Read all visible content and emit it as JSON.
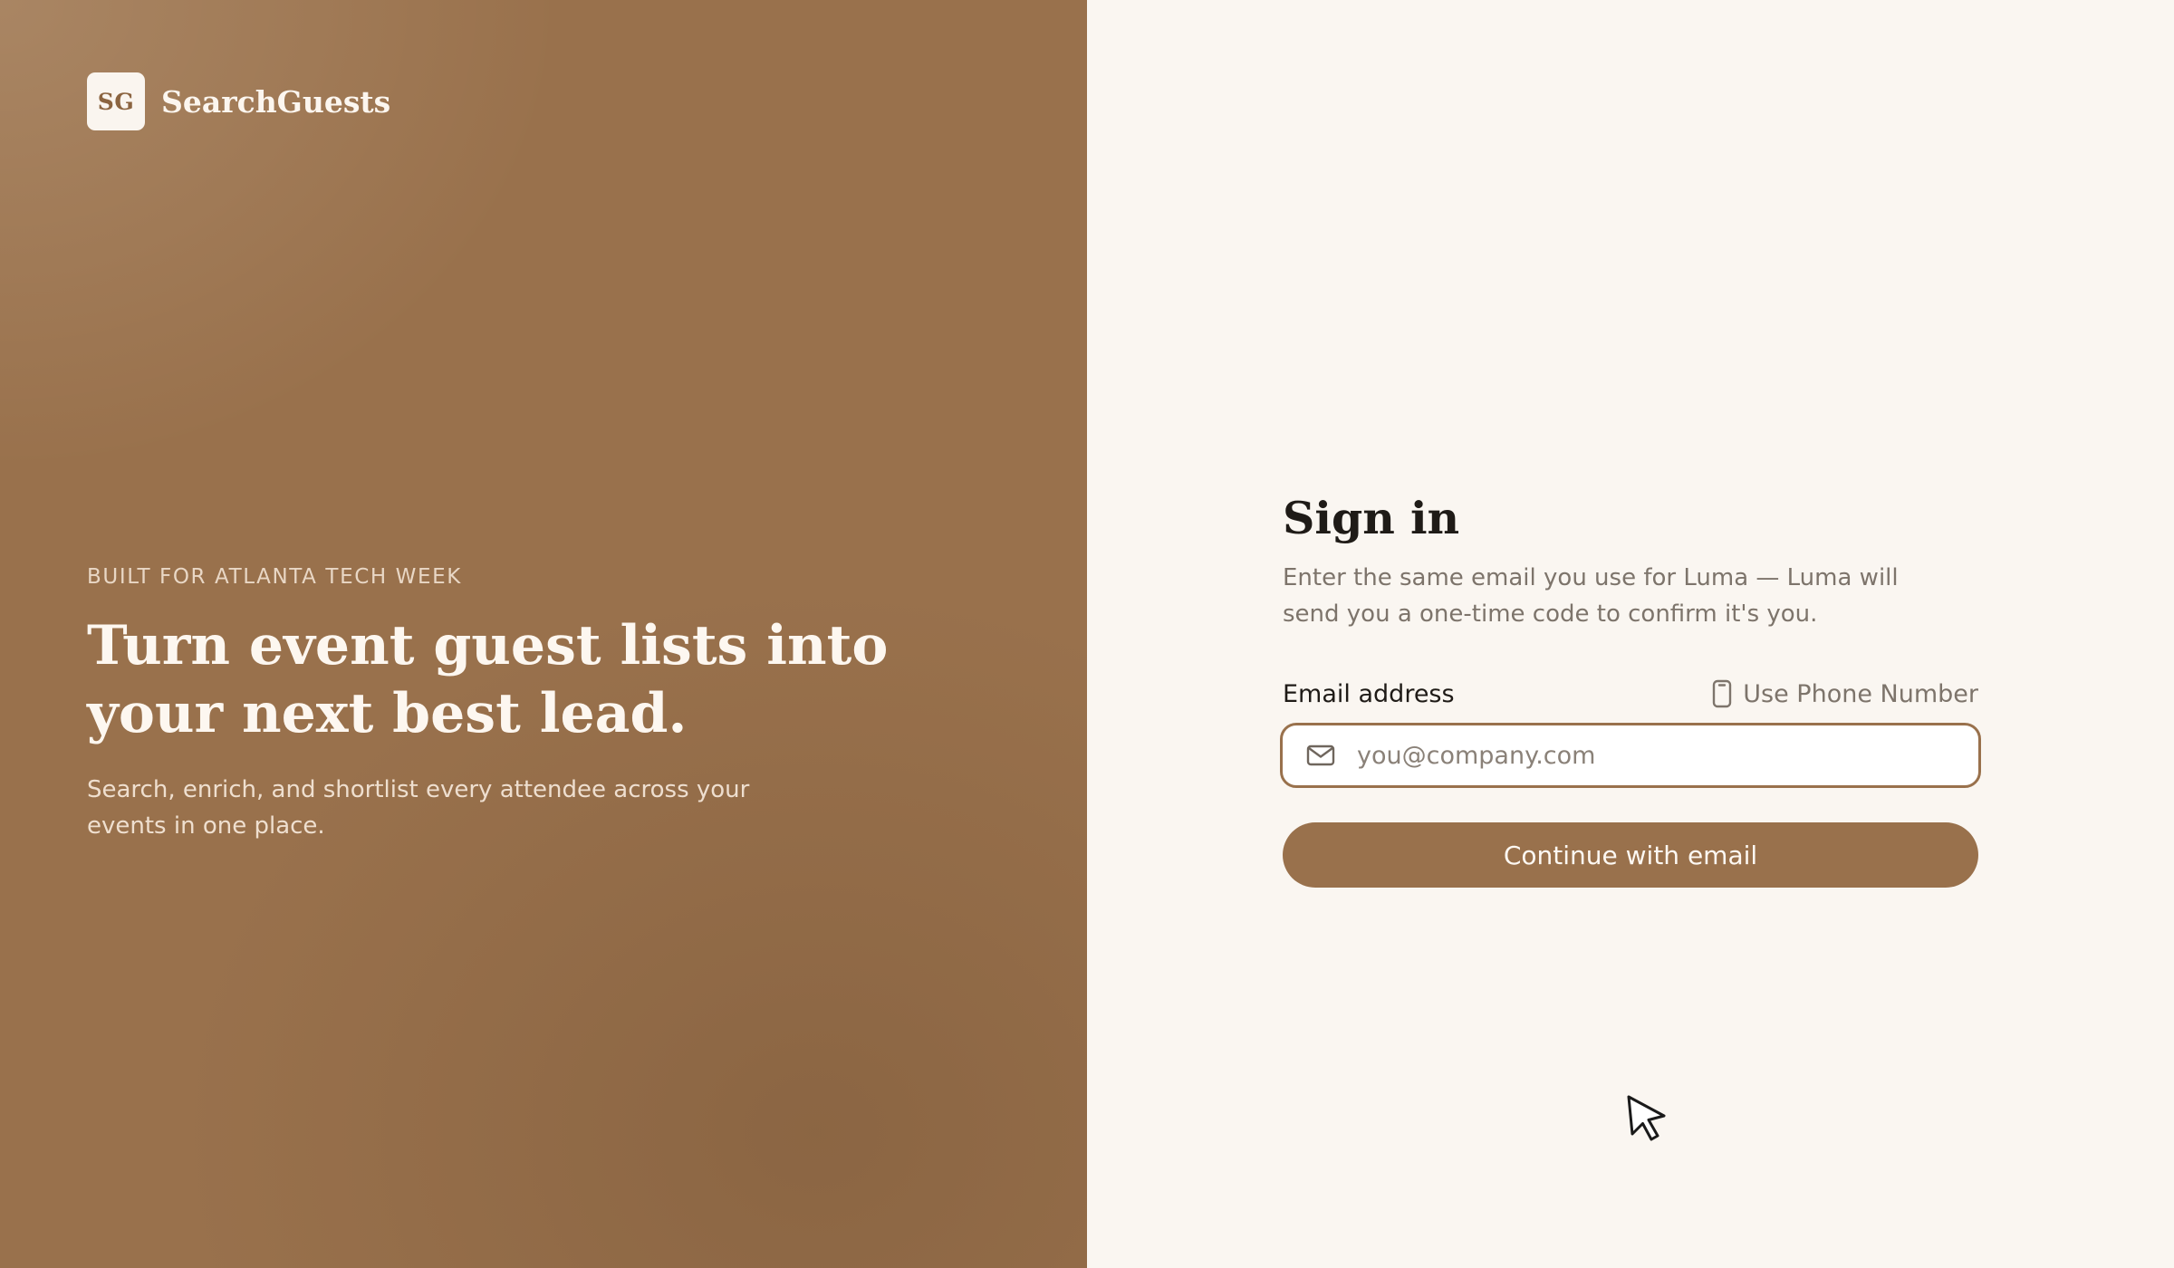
{
  "brand": {
    "mark": "SG",
    "name": "SearchGuests"
  },
  "hero": {
    "eyebrow": "BUILT FOR ATLANTA TECH WEEK",
    "title": "Turn event guest lists into your next best lead.",
    "subtitle": "Search, enrich, and shortlist every attendee across your events in one place."
  },
  "signin": {
    "title": "Sign in",
    "description": "Enter the same email you use for Luma — Luma will send you a one-time code to confirm it's you.",
    "email_label": "Email address",
    "phone_toggle_label": "Use Phone Number",
    "email_value": "",
    "email_placeholder": "you@company.com",
    "submit_label": "Continue with email"
  },
  "icons": {
    "email_field": "mail-icon",
    "phone_toggle": "phone-icon",
    "pointer": "mouse-cursor-icon"
  },
  "colors": {
    "brand_brown": "#99714c",
    "panel_background": "#faf6f1",
    "heading_text": "#1f1b17",
    "muted_text": "#7d746b"
  }
}
